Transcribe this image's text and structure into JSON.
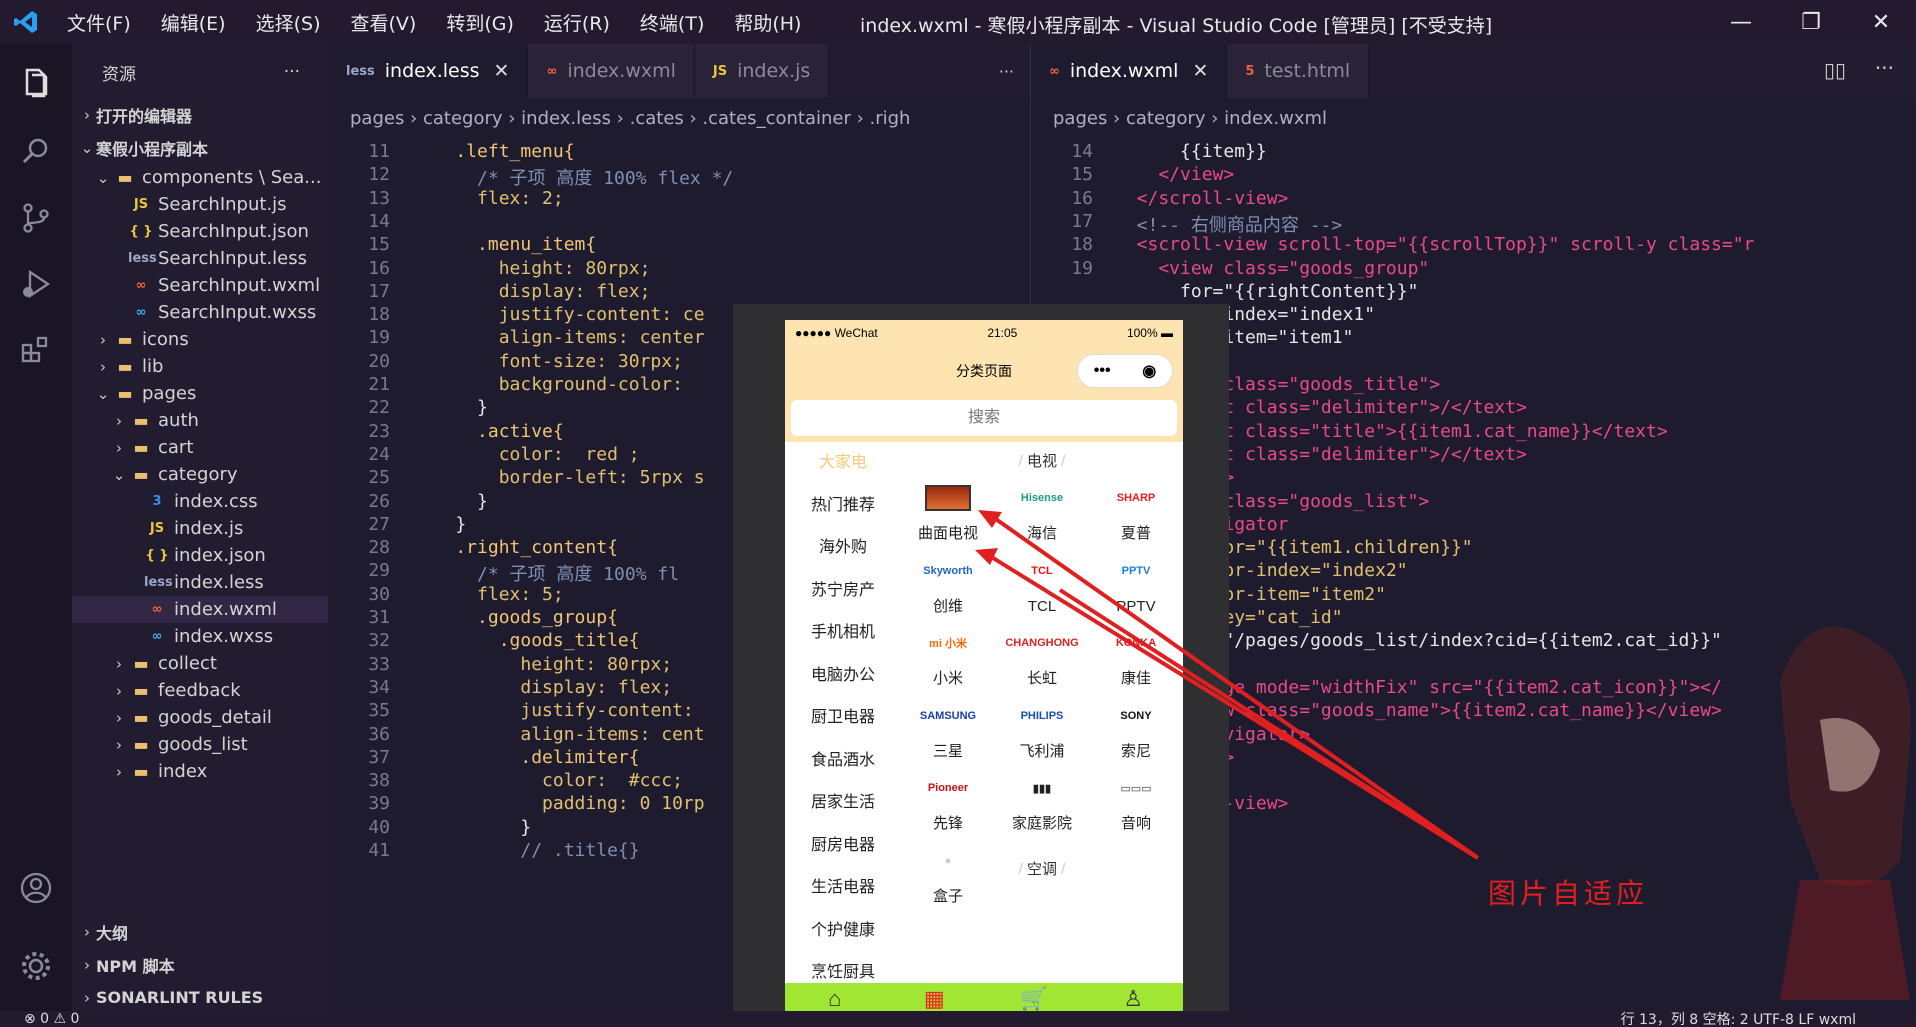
{
  "window": {
    "title": "index.wxml - 寒假小程序副本 - Visual Studio Code [管理员] [不受支持]",
    "menu": [
      "文件(F)",
      "编辑(E)",
      "选择(S)",
      "查看(V)",
      "转到(G)",
      "运行(R)",
      "终端(T)",
      "帮助(H)"
    ]
  },
  "sidebar": {
    "title": "资源",
    "open_editors": "打开的编辑器",
    "project": "寒假小程序副本",
    "items": [
      {
        "label": "components \\ Sea...",
        "icon": "folder-open-icon",
        "chev": "⌄"
      },
      {
        "label": "SearchInput.js",
        "icon": "js-file-icon",
        "badge": "JS",
        "color": "#e8c83a"
      },
      {
        "label": "SearchInput.json",
        "icon": "json-file-icon",
        "badge": "{ }",
        "color": "#e8c83a"
      },
      {
        "label": "SearchInput.less",
        "icon": "less-file-icon",
        "badge": "less",
        "color": "#9aa7c9"
      },
      {
        "label": "SearchInput.wxml",
        "icon": "wxml-file-icon",
        "badge": "∞",
        "color": "#f2653a"
      },
      {
        "label": "SearchInput.wxss",
        "icon": "wxss-file-icon",
        "badge": "∞",
        "color": "#3ab0f2"
      },
      {
        "label": "icons",
        "icon": "folder-icon",
        "chev": "›"
      },
      {
        "label": "lib",
        "icon": "folder-icon",
        "chev": "›"
      },
      {
        "label": "pages",
        "icon": "folder-open-icon",
        "chev": "⌄"
      },
      {
        "label": "auth",
        "icon": "folder-icon",
        "chev": "›"
      },
      {
        "label": "cart",
        "icon": "folder-icon",
        "chev": "›"
      },
      {
        "label": "category",
        "icon": "folder-open-icon",
        "chev": "⌄"
      },
      {
        "label": "index.css",
        "icon": "css-file-icon",
        "badge": "3",
        "color": "#3a8fe8"
      },
      {
        "label": "index.js",
        "icon": "js-file-icon",
        "badge": "JS",
        "color": "#e8c83a"
      },
      {
        "label": "index.json",
        "icon": "json-file-icon",
        "badge": "{ }",
        "color": "#e8c83a"
      },
      {
        "label": "index.less",
        "icon": "less-file-icon",
        "badge": "less",
        "color": "#9aa7c9"
      },
      {
        "label": "index.wxml",
        "icon": "wxml-file-icon",
        "badge": "∞",
        "color": "#f2653a"
      },
      {
        "label": "index.wxss",
        "icon": "wxss-file-icon",
        "badge": "∞",
        "color": "#3ab0f2"
      },
      {
        "label": "collect",
        "icon": "folder-icon",
        "chev": "›"
      },
      {
        "label": "feedback",
        "icon": "folder-icon",
        "chev": "›"
      },
      {
        "label": "goods_detail",
        "icon": "folder-icon",
        "chev": "›"
      },
      {
        "label": "goods_list",
        "icon": "folder-icon",
        "chev": "›"
      },
      {
        "label": "index",
        "icon": "folder-icon",
        "chev": "›"
      }
    ],
    "sections": [
      "大纲",
      "NPM 脚本",
      "SONARLINT RULES"
    ]
  },
  "left_editor": {
    "tabs": [
      "index.less",
      "index.wxml",
      "index.js"
    ],
    "breadcrumb": "pages › category › index.less › .cates › .cates_container › .righ",
    "lines": [
      {
        "n": "11",
        "t": "    .left_menu{"
      },
      {
        "n": "12",
        "t": "      /* 子项 高度 100% flex */"
      },
      {
        "n": "13",
        "t": "      flex: 2;"
      },
      {
        "n": "14",
        "t": ""
      },
      {
        "n": "15",
        "t": "      .menu_item{"
      },
      {
        "n": "16",
        "t": "        height: 80rpx;"
      },
      {
        "n": "17",
        "t": "        display: flex;"
      },
      {
        "n": "18",
        "t": "        justify-content: ce"
      },
      {
        "n": "19",
        "t": "        align-items: center"
      },
      {
        "n": "20",
        "t": "        font-size: 30rpx;"
      },
      {
        "n": "21",
        "t": "        background-color:"
      },
      {
        "n": "22",
        "t": "      }"
      },
      {
        "n": "23",
        "t": "      .active{"
      },
      {
        "n": "24",
        "t": "        color:  red ;"
      },
      {
        "n": "25",
        "t": "        border-left: 5rpx s"
      },
      {
        "n": "26",
        "t": "      }"
      },
      {
        "n": "27",
        "t": "    }"
      },
      {
        "n": "28",
        "t": "    .right_content{"
      },
      {
        "n": "29",
        "t": "      /* 子项 高度 100% fl"
      },
      {
        "n": "30",
        "t": "      flex: 5;"
      },
      {
        "n": "31",
        "t": "      .goods_group{"
      },
      {
        "n": "32",
        "t": "        .goods_title{"
      },
      {
        "n": "33",
        "t": "          height: 80rpx;"
      },
      {
        "n": "34",
        "t": "          display: flex;"
      },
      {
        "n": "35",
        "t": "          justify-content:"
      },
      {
        "n": "36",
        "t": "          align-items: cent"
      },
      {
        "n": "37",
        "t": "          .delimiter{"
      },
      {
        "n": "38",
        "t": "            color:  #ccc;"
      },
      {
        "n": "39",
        "t": "            padding: 0 10rp"
      },
      {
        "n": "40",
        "t": "          }"
      },
      {
        "n": "41",
        "t": "          // .title{}"
      }
    ]
  },
  "right_editor": {
    "tabs": [
      "index.wxml",
      "test.html"
    ],
    "breadcrumb": "pages › category › index.wxml",
    "lines": [
      {
        "n": "14",
        "t": "      {{item}}"
      },
      {
        "n": "15",
        "t": "    </view>"
      },
      {
        "n": "16",
        "t": "  </scroll-view>"
      },
      {
        "n": "17",
        "t": "  <!-- 右侧商品内容 -->"
      },
      {
        "n": "18",
        "t": "  <scroll-view scroll-top=\"{{scrollTop}}\" scroll-y class=\"r"
      },
      {
        "n": "19",
        "t": "    <view class=\"goods_group\""
      },
      {
        "n": "",
        "t": "      for=\"{{rightContent}}\""
      },
      {
        "n": "",
        "t": "      for-index=\"index1\""
      },
      {
        "n": "",
        "t": "      for-item=\"item1\""
      },
      {
        "n": "",
        "t": ""
      },
      {
        "n": "",
        "t": "    <view class=\"goods_title\">"
      },
      {
        "n": "",
        "t": "      <text class=\"delimiter\">/</text>"
      },
      {
        "n": "",
        "t": "      <text class=\"title\">{{item1.cat_name}}</text>"
      },
      {
        "n": "",
        "t": "      <text class=\"delimiter\">/</text>"
      },
      {
        "n": "",
        "t": "    </view>"
      },
      {
        "n": "",
        "t": "    <view class=\"goods_list\">"
      },
      {
        "n": "",
        "t": "      <navigator"
      },
      {
        "n": "",
        "t": "      wx:for=\"{{item1.children}}\""
      },
      {
        "n": "",
        "t": "      wx:for-index=\"index2\""
      },
      {
        "n": "",
        "t": "      wx:for-item=\"item2\""
      },
      {
        "n": "",
        "t": "      wx:key=\"cat_id\""
      },
      {
        "n": "",
        "t": "      url=\"/pages/goods_list/index?cid={{item2.cat_id}}\""
      },
      {
        "n": "",
        "t": "      >"
      },
      {
        "n": "",
        "t": "      <image mode=\"widthFix\" src=\"{{item2.cat_icon}}\"></"
      },
      {
        "n": "",
        "t": "      <view class=\"goods_name\">{{item2.cat_name}}</view>"
      },
      {
        "n": "",
        "t": "      </navigator>"
      },
      {
        "n": "",
        "t": "    </view>"
      },
      {
        "n": "",
        "t": "  </view>"
      },
      {
        "n": "",
        "t": "  </scroll-view>"
      }
    ]
  },
  "annotation": "图片自适应",
  "phone": {
    "carrier": "●●●●● WeChat",
    "time": "21:05",
    "battery": "100%",
    "nav_title": "分类页面",
    "search_placeholder": "搜索",
    "left_menu": [
      "大家电",
      "热门推荐",
      "海外购",
      "苏宁房产",
      "手机相机",
      "电脑办公",
      "厨卫电器",
      "食品酒水",
      "居家生活",
      "厨房电器",
      "生活电器",
      "个护健康",
      "烹饪厨具"
    ],
    "group_titles": [
      "电视",
      "空调"
    ],
    "goods": [
      {
        "name": "曲面电视",
        "brand": "",
        "color": "#b53"
      },
      {
        "name": "海信",
        "brand": "Hisense",
        "color": "#1a9a8a"
      },
      {
        "name": "夏普",
        "brand": "SHARP",
        "color": "#d22"
      },
      {
        "name": "创维",
        "brand": "Skyworth",
        "color": "#2366c9"
      },
      {
        "name": "TCL",
        "brand": "TCL",
        "color": "#e11"
      },
      {
        "name": "PPTV",
        "brand": "PPTV",
        "color": "#1a7de0"
      },
      {
        "name": "小米",
        "brand": "mi 小米",
        "color": "#f60"
      },
      {
        "name": "长虹",
        "brand": "CHANGHONG",
        "color": "#d22"
      },
      {
        "name": "康佳",
        "brand": "KONKA",
        "color": "#d22"
      },
      {
        "name": "三星",
        "brand": "SAMSUNG",
        "color": "#1a3ea8"
      },
      {
        "name": "飞利浦",
        "brand": "PHILIPS",
        "color": "#1a4fb0"
      },
      {
        "name": "索尼",
        "brand": "SONY",
        "color": "#111"
      },
      {
        "name": "先锋",
        "brand": "Pioneer",
        "color": "#c11"
      },
      {
        "name": "家庭影院",
        "brand": "▮▮▮",
        "color": "#222"
      },
      {
        "name": "音响",
        "brand": "▭▭▭",
        "color": "#888"
      },
      {
        "name": "盒子",
        "brand": "●",
        "color": "#ccc"
      }
    ],
    "tabbar": [
      "首页",
      "分类",
      "购物车",
      "我的"
    ]
  },
  "status": {
    "left": "⊗ 0 ⚠ 0",
    "right": "行 13，列 8   空格: 2   UTF-8   LF   wxml"
  },
  "colors": {
    "accent": "#f2653a",
    "red": "#e02020",
    "tabbar": "#a0e633"
  }
}
